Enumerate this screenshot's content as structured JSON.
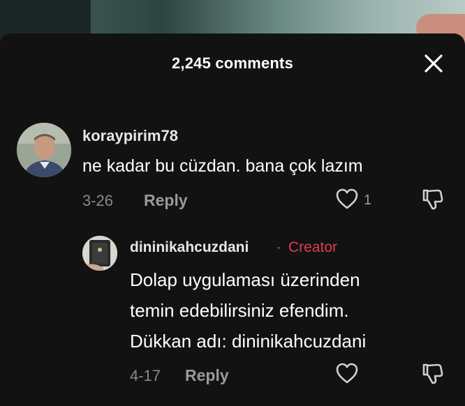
{
  "header": {
    "title": "2,245 comments"
  },
  "comments": [
    {
      "username": "koraypirim78",
      "text": "ne kadar bu cüzdan. bana çok lazım",
      "date": "3-26",
      "reply_label": "Reply",
      "like_count": "1"
    }
  ],
  "reply": {
    "username": "dininikahcuzdani",
    "separator": "·",
    "badge": "Creator",
    "text_lines": [
      "Dolap uygulaması üzerinden",
      "temin edebilirsiniz efendim.",
      "Dükkan adı: dininikahcuzdani"
    ],
    "date": "4-17",
    "reply_label": "Reply"
  },
  "colors": {
    "sheet_background": "#121212",
    "creator_badge": "#e03a55",
    "muted_text": "#8a8a8a"
  },
  "icons": [
    "close-icon",
    "heart-icon",
    "dislike-icon"
  ]
}
